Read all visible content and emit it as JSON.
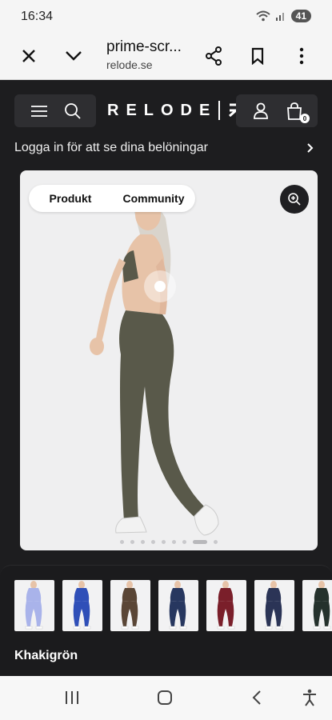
{
  "status": {
    "time": "16:34",
    "battery": "41"
  },
  "browser": {
    "title": "prime-scr...",
    "host": "relode.se"
  },
  "site": {
    "logo": "RELODE",
    "cart_count": "0",
    "login_prompt": "Logga in för att se dina belöningar",
    "tabs": [
      "Produkt",
      "Community"
    ],
    "gallery": {
      "slide_count": 9,
      "active_index": 7
    },
    "variants": [
      {
        "name": "lavender",
        "color": "#a9b3ea"
      },
      {
        "name": "royal-blue",
        "color": "#2f4fb8"
      },
      {
        "name": "brown",
        "color": "#5a4636"
      },
      {
        "name": "navy",
        "color": "#27375f"
      },
      {
        "name": "burgundy",
        "color": "#7a1f2a"
      },
      {
        "name": "dark-navy",
        "color": "#2b3456"
      },
      {
        "name": "dark-green",
        "color": "#24312c"
      }
    ],
    "selected_color": "Khakigrön"
  },
  "colors": {
    "legging": "#59594a",
    "skin": "#e7c3a8",
    "hair": "#d9d4cc"
  }
}
